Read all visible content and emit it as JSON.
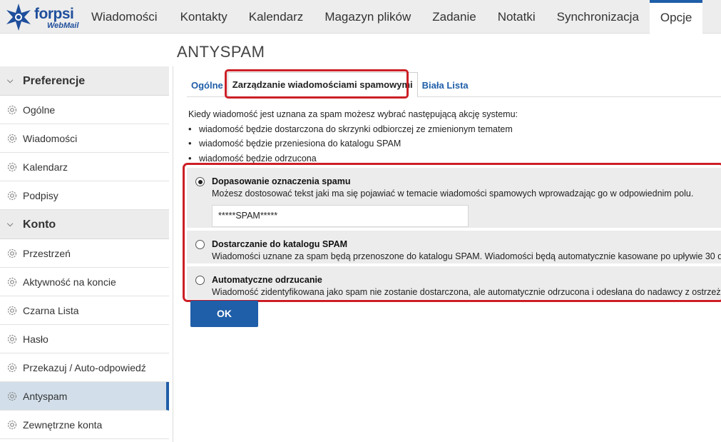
{
  "brand": {
    "name": "forpsi",
    "sub": "WebMail"
  },
  "nav": {
    "items": [
      "Wiadomości",
      "Kontakty",
      "Kalendarz",
      "Magazyn plików",
      "Zadanie",
      "Notatki",
      "Synchronizacja",
      "Opcje"
    ],
    "active": "Opcje"
  },
  "page": {
    "title": "ANTYSPAM"
  },
  "sidebar": {
    "sections": [
      {
        "label": "Preferencje",
        "items": [
          "Ogólne",
          "Wiadomości",
          "Kalendarz",
          "Podpisy"
        ]
      },
      {
        "label": "Konto",
        "items": [
          "Przestrzeń",
          "Aktywność na koncie",
          "Czarna Lista",
          "Hasło",
          "Przekazuj / Auto-odpowiedź",
          "Antyspam",
          "Zewnętrzne konta"
        ]
      }
    ],
    "active": "Antyspam"
  },
  "tabs": {
    "items": [
      "Ogólne",
      "Zarządzanie wiadomościami spamowymi",
      "Biała Lista"
    ],
    "active": 1
  },
  "content": {
    "intro": "Kiedy wiadomość jest uznana za spam możesz wybrać następującą akcję systemu:",
    "bullets": [
      "wiadomość będzie dostarczona do skrzynki odbiorczej ze zmienionym tematem",
      "wiadomość będzie przeniesiona do katalogu SPAM",
      "wiadomość będzie odrzucona"
    ],
    "options": [
      {
        "title": "Dopasowanie oznaczenia spamu",
        "text": "Możesz dostosować tekst jaki ma się pojawiać w temacie wiadomości spamowych wprowadzając go w odpowiednim polu.",
        "selected": true,
        "input_value": "*****SPAM*****"
      },
      {
        "title": "Dostarczanie do katalogu SPAM",
        "text": "Wiadomości uznane za spam będą przenoszone do katalogu SPAM. Wiadomości będą automatycznie kasowane po upływie 30 d",
        "selected": false
      },
      {
        "title": "Automatyczne odrzucanie",
        "text": "Wiadomość zidentyfikowana jako spam nie zostanie dostarczona, ale automatycznie odrzucona i odesłana do nadawcy z ostrzeż",
        "selected": false
      }
    ],
    "ok_label": "OK"
  },
  "colors": {
    "accent": "#1f5ea8",
    "highlight": "#cc1f26",
    "active_sidebar": "#d2dfea"
  }
}
